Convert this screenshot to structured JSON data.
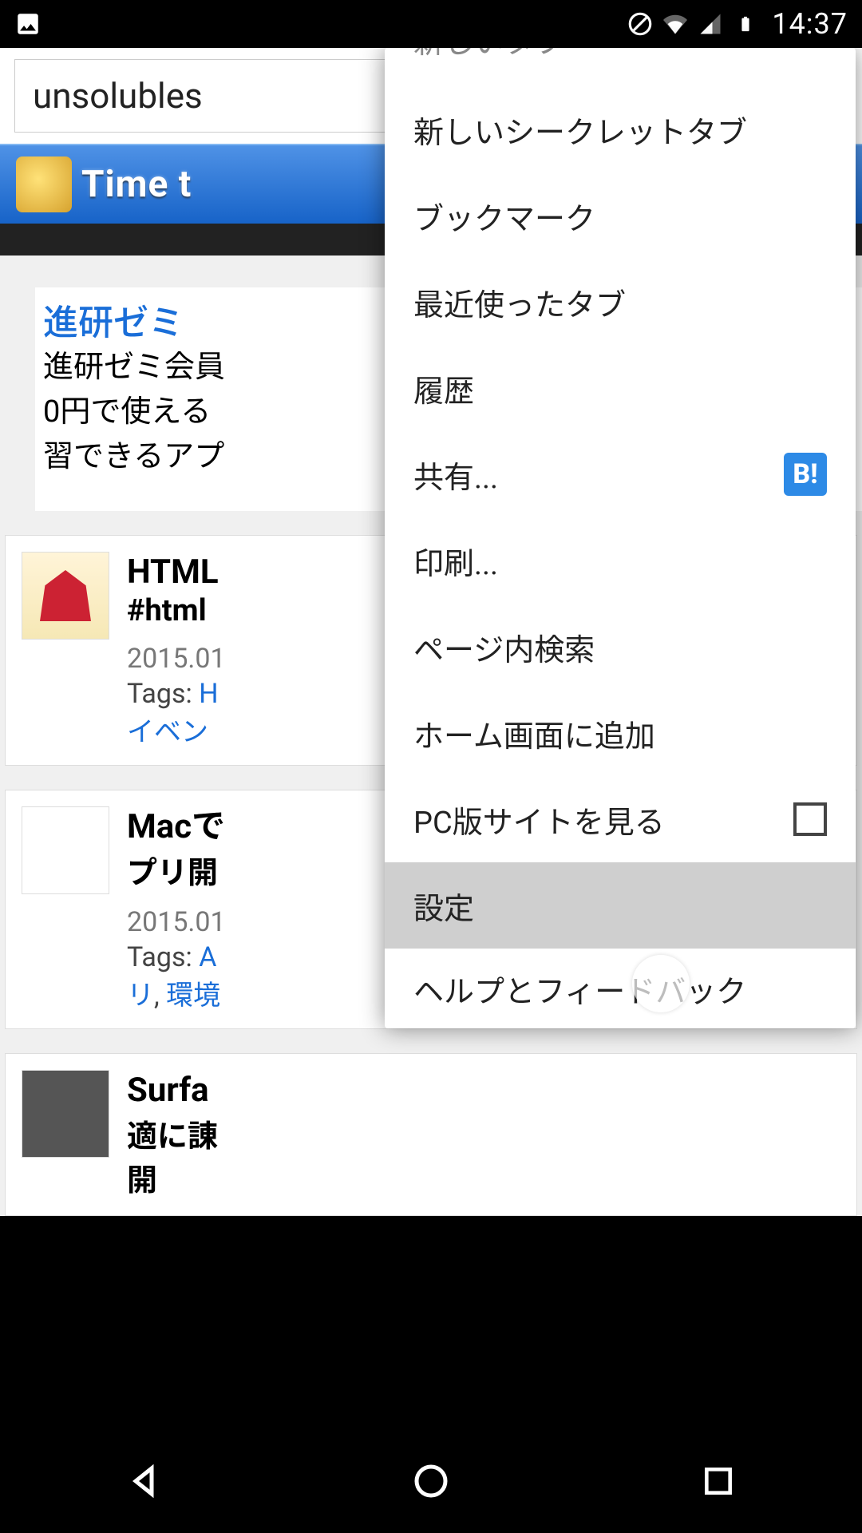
{
  "status": {
    "time": "14:37"
  },
  "omnibox": {
    "value": "unsolubles"
  },
  "page_header": {
    "title": "Time t"
  },
  "ad": {
    "title": "進研ゼミ",
    "line1": "進研ゼミ会員",
    "line2": "0円で使える",
    "line3": "習できるアプ"
  },
  "articles": [
    {
      "title": "HTML",
      "sub": "#html",
      "date": "2015.01",
      "tags_label": "Tags: ",
      "tag1": "H",
      "tag2": "イベン"
    },
    {
      "title": "Macで",
      "sub": "プリ開",
      "date": "2015.01",
      "tags_label": "Tags: ",
      "tag1": "A",
      "tag2": "リ",
      "tag3": "環境"
    },
    {
      "title": "Surfa",
      "sub": "適に諌",
      "sub2": "開"
    }
  ],
  "menu": {
    "cutoff": "新しいタブ",
    "items": [
      "新しいシークレットタブ",
      "ブックマーク",
      "最近使ったタブ",
      "履歴",
      "共有...",
      "印刷...",
      "ページ内検索",
      "ホーム画面に追加",
      "PC版サイトを見る",
      "設定",
      "ヘルプとフィードバック"
    ],
    "share_badge": "B!"
  }
}
